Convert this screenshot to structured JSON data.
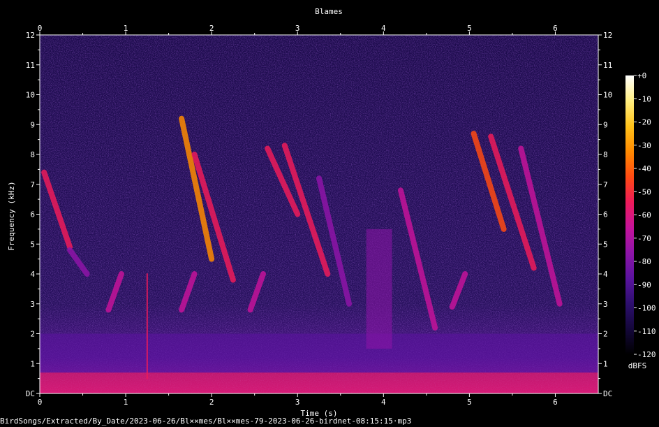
{
  "chart_data": {
    "type": "heatmap",
    "title": "Blames",
    "xlabel": "Time (s)",
    "ylabel": "Frequency (kHz)",
    "xlim": [
      0,
      6.5
    ],
    "ylim": [
      0,
      12
    ],
    "x_ticks": [
      "0",
      "1",
      "2",
      "3",
      "4",
      "5",
      "6"
    ],
    "y_ticks": [
      "DC",
      "1",
      "2",
      "3",
      "4",
      "5",
      "6",
      "7",
      "8",
      "9",
      "10",
      "11",
      "12"
    ],
    "colorbar": {
      "label": "dBFS",
      "range": [
        -120,
        0
      ],
      "ticks": [
        "+0",
        "-10",
        "-20",
        "-30",
        "-40",
        "-50",
        "-60",
        "-70",
        "-80",
        "-90",
        "-100",
        "-110",
        "-120"
      ],
      "colors": [
        "#000000",
        "#14073a",
        "#2d0f6e",
        "#5a139e",
        "#8e14a8",
        "#c5139a",
        "#ee1b5a",
        "#ff4a12",
        "#ff8a00",
        "#ffc21a",
        "#ffee80",
        "#ffffff"
      ]
    },
    "features": [
      {
        "label": "low hum",
        "t": [
          0.0,
          6.5
        ],
        "f": [
          0.0,
          0.7
        ],
        "level": 0.55
      },
      {
        "label": "low band",
        "t": [
          0.0,
          6.5
        ],
        "f": [
          0.7,
          2.0
        ],
        "level": 0.25
      },
      {
        "label": "sweep",
        "t": [
          0.05,
          0.35
        ],
        "f": [
          7.4,
          4.9
        ],
        "level": 0.55
      },
      {
        "label": "sweep",
        "t": [
          0.35,
          0.55
        ],
        "f": [
          4.8,
          4.0
        ],
        "level": 0.4
      },
      {
        "label": "hook",
        "t": [
          0.8,
          0.95
        ],
        "f": [
          2.8,
          4.0
        ],
        "level": 0.45
      },
      {
        "label": "click",
        "t": [
          1.25,
          1.25
        ],
        "f": [
          0.5,
          4.0
        ],
        "level": 0.5
      },
      {
        "label": "sweep",
        "t": [
          1.65,
          2.0
        ],
        "f": [
          9.2,
          4.5
        ],
        "level": 0.7
      },
      {
        "label": "sweep",
        "t": [
          1.8,
          2.25
        ],
        "f": [
          8.0,
          3.8
        ],
        "level": 0.55
      },
      {
        "label": "hook",
        "t": [
          1.65,
          1.8
        ],
        "f": [
          2.8,
          4.0
        ],
        "level": 0.45
      },
      {
        "label": "sweep",
        "t": [
          2.65,
          3.0
        ],
        "f": [
          8.2,
          6.0
        ],
        "level": 0.55
      },
      {
        "label": "sweep",
        "t": [
          2.85,
          3.35
        ],
        "f": [
          8.3,
          4.0
        ],
        "level": 0.5
      },
      {
        "label": "hook",
        "t": [
          2.45,
          2.6
        ],
        "f": [
          2.8,
          4.0
        ],
        "level": 0.45
      },
      {
        "label": "sweep",
        "t": [
          3.25,
          3.6
        ],
        "f": [
          7.2,
          3.0
        ],
        "level": 0.35
      },
      {
        "label": "burst",
        "t": [
          3.8,
          4.1
        ],
        "f": [
          1.5,
          5.5
        ],
        "level": 0.35
      },
      {
        "label": "sweep",
        "t": [
          4.2,
          4.6
        ],
        "f": [
          6.8,
          2.2
        ],
        "level": 0.45
      },
      {
        "label": "hook",
        "t": [
          4.8,
          4.95
        ],
        "f": [
          2.9,
          4.0
        ],
        "level": 0.45
      },
      {
        "label": "sweep",
        "t": [
          5.05,
          5.4
        ],
        "f": [
          8.7,
          5.5
        ],
        "level": 0.65
      },
      {
        "label": "sweep",
        "t": [
          5.25,
          5.75
        ],
        "f": [
          8.6,
          4.2
        ],
        "level": 0.55
      },
      {
        "label": "sweep",
        "t": [
          5.6,
          6.05
        ],
        "f": [
          8.2,
          3.0
        ],
        "level": 0.45
      }
    ]
  },
  "footer": {
    "path": "BirdSongs/Extracted/By_Date/2023-06-26/Bl××mes/Bl××mes-79-2023-06-26-birdnet-08:15:15·mp3"
  }
}
